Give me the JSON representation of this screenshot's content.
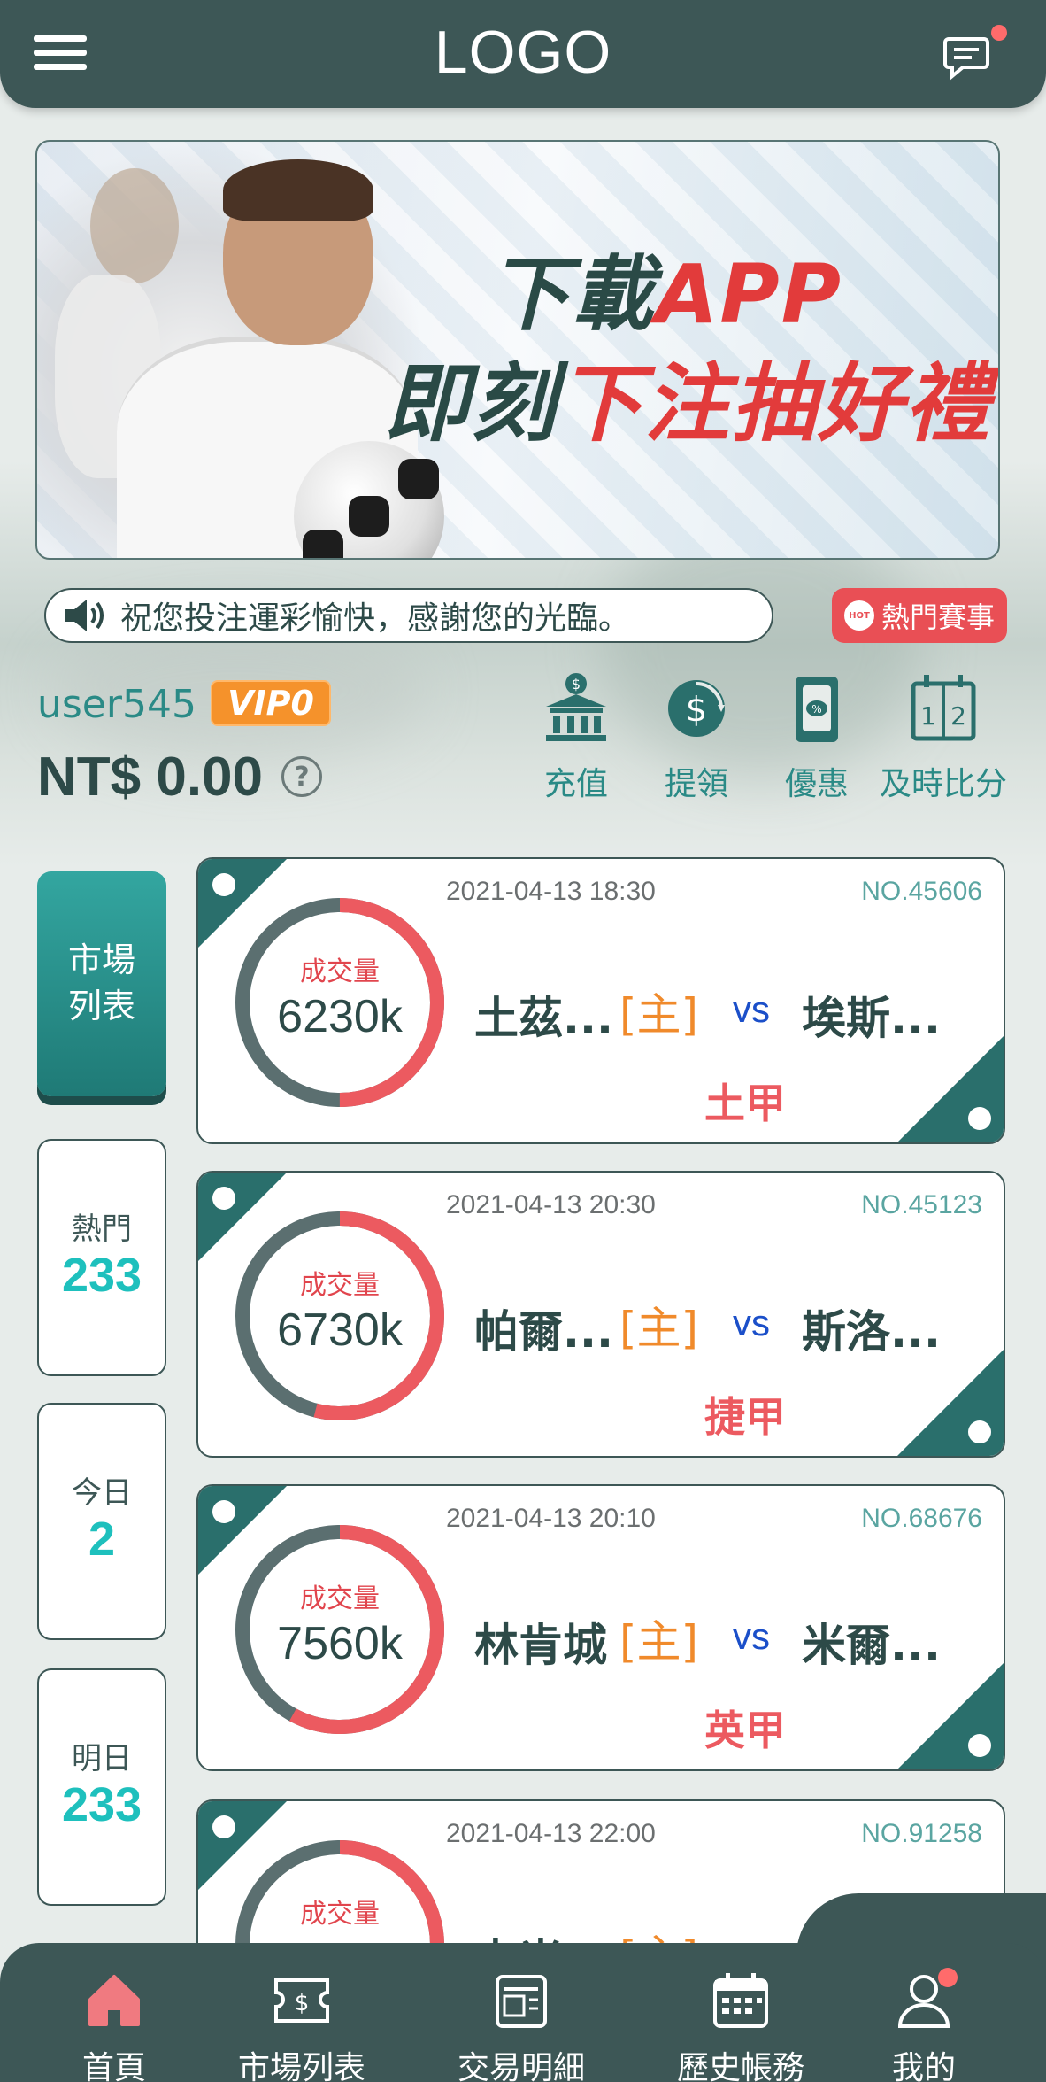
{
  "header": {
    "logo": "LOGO",
    "menu_icon": "hamburger-menu-icon",
    "message_icon": "chat-bubble-icon",
    "has_notification": true
  },
  "banner": {
    "line1_prefix": "下載",
    "line1_accent": "APP",
    "line2_prefix": "即刻",
    "line2_mid": "下注",
    "line2_accent": "抽好禮"
  },
  "announcement": {
    "icon": "speaker-icon",
    "text": "祝您投注運彩愉快，感謝您的光臨。"
  },
  "hot_button": {
    "badge": "HOT",
    "label": "熱門賽事"
  },
  "user": {
    "name": "user545",
    "vip": "VIP0",
    "balance": "NT$ 0.00",
    "help_icon": "question-circle-icon"
  },
  "actions": [
    {
      "label": "充值",
      "icon": "bank-dollar-icon"
    },
    {
      "label": "提領",
      "icon": "dollar-cycle-icon"
    },
    {
      "label": "優惠",
      "icon": "coupon-icon"
    },
    {
      "label": "及時比分",
      "icon": "scoreboard-icon"
    }
  ],
  "filters": [
    {
      "title": "市場\n列表",
      "count": ""
    },
    {
      "title": "熱門",
      "count": "233"
    },
    {
      "title": "今日",
      "count": "2"
    },
    {
      "title": "明日",
      "count": "233"
    }
  ],
  "volume_label": "成交量",
  "home_tag": "[主]",
  "vs": "vs",
  "matches": [
    {
      "time": "2021-04-13 18:30",
      "no": "NO.45606",
      "volume": "6230k",
      "volume_ratio": 0.5,
      "home": "土茲...",
      "away": "埃斯...",
      "league": "土甲"
    },
    {
      "time": "2021-04-13 20:30",
      "no": "NO.45123",
      "volume": "6730k",
      "volume_ratio": 0.54,
      "home": "帕爾...",
      "away": "斯洛...",
      "league": "捷甲"
    },
    {
      "time": "2021-04-13 20:10",
      "no": "NO.68676",
      "volume": "7560k",
      "volume_ratio": 0.58,
      "home": "林肯城",
      "away": "米爾...",
      "league": "英甲"
    },
    {
      "time": "2021-04-13 22:00",
      "no": "NO.91258",
      "volume": "",
      "volume_ratio": 0.5,
      "home": "卡米...",
      "away": "",
      "league": ""
    }
  ],
  "bottom_nav": [
    {
      "label": "首頁",
      "icon": "home-icon",
      "active": true
    },
    {
      "label": "市場列表",
      "icon": "ticket-dollar-icon",
      "active": false
    },
    {
      "label": "交易明細",
      "icon": "receipt-icon",
      "active": false
    },
    {
      "label": "歷史帳務",
      "icon": "calendar-icon",
      "active": false
    },
    {
      "label": "我的",
      "icon": "user-icon",
      "active": false
    }
  ],
  "colors": {
    "primary_dark": "#3d5756",
    "teal": "#2a8a86",
    "accent_red": "#e94f55",
    "vip_orange": "#f5922b",
    "count_cyan": "#1ec0bd"
  }
}
